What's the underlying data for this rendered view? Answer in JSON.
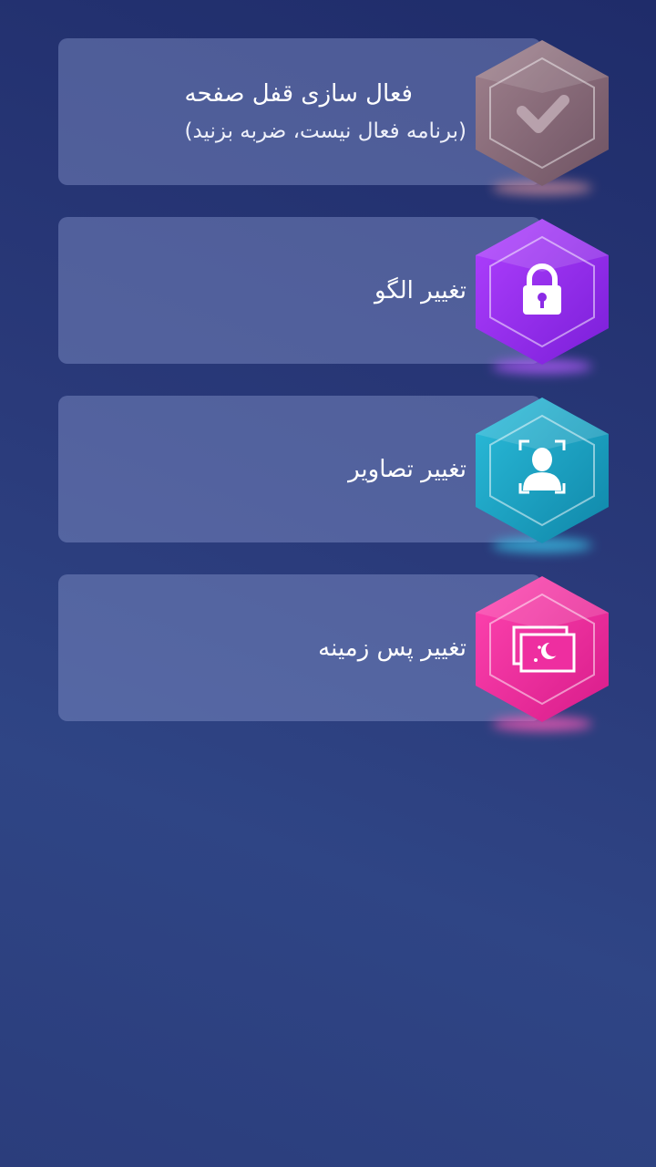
{
  "menu": {
    "items": [
      {
        "id": "lock-activation",
        "title": "فعال سازی قفل صفحه",
        "subtitle": "(برنامه فعال نیست، ضربه بزنید)",
        "icon": "checkmark-icon",
        "badge_color": "#8a6a78"
      },
      {
        "id": "change-pattern",
        "title": "تغییر الگو",
        "icon": "padlock-icon",
        "badge_color": "#9b2cf0"
      },
      {
        "id": "change-images",
        "title": "تغییر تصاویر",
        "icon": "face-scan-icon",
        "badge_color": "#1aa5c4"
      },
      {
        "id": "change-wallpaper",
        "title": "تغییر پس زمینه",
        "icon": "wallpaper-icon",
        "badge_color": "#ee2ea0"
      }
    ]
  }
}
